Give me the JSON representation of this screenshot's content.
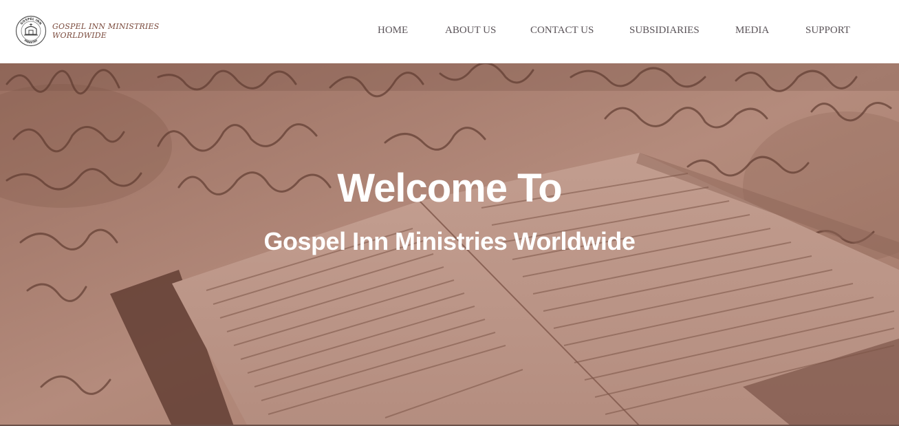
{
  "brand": {
    "name_line1": "GOSPEL INN MINISTRIES",
    "name_line2": "WORLDWIDE",
    "seal_text_top": "GOSPEL INN",
    "seal_text_bottom": "MINISTRY"
  },
  "nav": {
    "items": [
      {
        "label": "HOME"
      },
      {
        "label": "ABOUT US"
      },
      {
        "label": "CONTACT US"
      },
      {
        "label": "SUBSIDIARIES"
      },
      {
        "label": "MEDIA"
      },
      {
        "label": "SUPPORT"
      }
    ]
  },
  "hero": {
    "title": "Welcome To",
    "subtitle": "Gospel Inn Ministries Worldwide"
  },
  "colors": {
    "hero_tint": "#a87e6f",
    "brand_text": "#7a4a3c",
    "nav_text": "#5a5358"
  }
}
